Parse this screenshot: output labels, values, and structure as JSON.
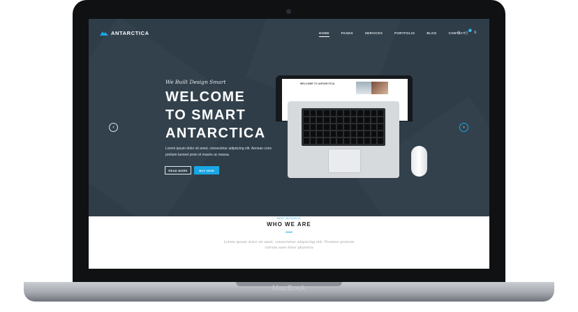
{
  "site": {
    "logo": "ANTARCTICA",
    "nav": [
      "HOME",
      "PAGES",
      "SERVICES",
      "PORTFOLIO",
      "BLOG",
      "CONTACT"
    ],
    "icons": [
      "search-icon",
      "cart-icon",
      "menu-icon"
    ],
    "cart_count": "0"
  },
  "hero": {
    "kicker": "We Built Design Smart",
    "title_lines": [
      "WELCOME",
      "TO SMART",
      "ANTARCTICA"
    ],
    "description": "Lorem ipsum dolor sit amet, consectetur adipiscing elit. Aenean conv pretium laoreet proin et mauris ac massa.",
    "btn_read": "READ MORE",
    "btn_buy": "BUY NOW",
    "mini_title": "WELCOME TO ANTARCTICA"
  },
  "section": {
    "kicker": "BEST BUSINESS",
    "title": "WHO WE ARE",
    "line1": "Lorem ipsum dolor sit amet, consectetur adipiscing elit. Vivamus pretium",
    "line2": "rutrum ante dolor pharetra"
  },
  "device": {
    "label": "MacBook"
  },
  "colors": {
    "hero_bg": "#2f3d48",
    "accent": "#1aa7e5"
  }
}
